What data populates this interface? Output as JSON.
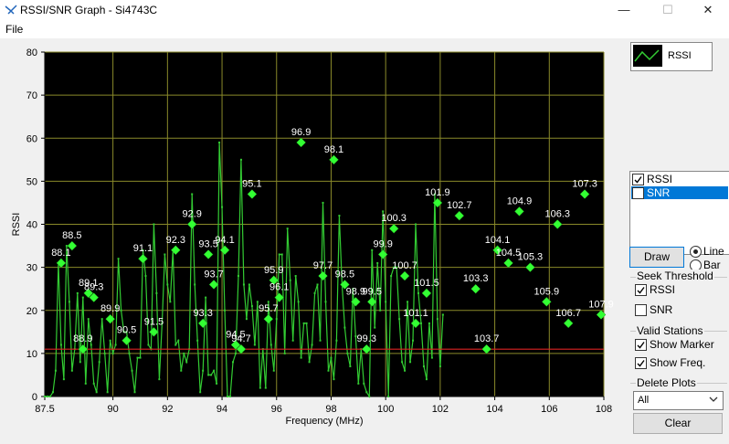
{
  "window": {
    "title": "RSSI/SNR Graph - Si4743C",
    "minimize": "—",
    "maximize": "☐",
    "close": "✕"
  },
  "menu": {
    "file": "File"
  },
  "legend": {
    "label": "RSSI",
    "color": "#22cc22"
  },
  "series_list": {
    "items": [
      {
        "label": "RSSI",
        "checked": true,
        "selected": false
      },
      {
        "label": "SNR",
        "checked": false,
        "selected": true
      }
    ]
  },
  "controls": {
    "draw": "Draw",
    "line": "Line",
    "bar": "Bar",
    "mode": "Line",
    "seek_threshold": {
      "title": "Seek Threshold",
      "rssi": {
        "label": "RSSI",
        "checked": true
      },
      "snr": {
        "label": "SNR",
        "checked": false
      }
    },
    "valid_stations": {
      "title": "Valid Stations",
      "show_marker": {
        "label": "Show Marker",
        "checked": true
      },
      "show_freq": {
        "label": "Show Freq.",
        "checked": true
      }
    },
    "delete_plots": {
      "title": "Delete Plots",
      "value": "All"
    },
    "clear": "Clear"
  },
  "chart_data": {
    "type": "line",
    "xlabel": "Frequency (MHz)",
    "ylabel": "RSSI",
    "xlim": [
      87.5,
      108
    ],
    "ylim": [
      0,
      80
    ],
    "yticks": [
      0,
      10,
      20,
      30,
      40,
      50,
      60,
      70,
      80
    ],
    "xticks": [
      "87.5",
      "90",
      "92",
      "94",
      "96",
      "98",
      "100",
      "102",
      "104",
      "106",
      "108"
    ],
    "xtick_values": [
      87.5,
      90,
      92,
      94,
      96,
      98,
      100,
      102,
      104,
      106,
      108
    ],
    "threshold": 11,
    "grid": true,
    "background": "#000000",
    "grid_color": "#8a8a2a",
    "line_color": "#33cc33",
    "marker_color": "#33ff33",
    "threshold_color": "#dd2222",
    "x": [
      87.5,
      87.6,
      87.7,
      87.8,
      87.9,
      88.0,
      88.1,
      88.2,
      88.3,
      88.4,
      88.5,
      88.6,
      88.7,
      88.8,
      88.9,
      89.0,
      89.1,
      89.2,
      89.3,
      89.4,
      89.5,
      89.6,
      89.7,
      89.8,
      89.9,
      90.0,
      90.1,
      90.2,
      90.3,
      90.4,
      90.5,
      90.6,
      90.7,
      90.8,
      90.9,
      91.0,
      91.1,
      91.2,
      91.3,
      91.4,
      91.5,
      91.6,
      91.7,
      91.8,
      91.9,
      92.0,
      92.1,
      92.2,
      92.3,
      92.4,
      92.5,
      92.6,
      92.7,
      92.8,
      92.9,
      93.0,
      93.1,
      93.2,
      93.3,
      93.4,
      93.5,
      93.6,
      93.7,
      93.8,
      93.9,
      94.0,
      94.1,
      94.2,
      94.3,
      94.4,
      94.5,
      94.6,
      94.7,
      94.8,
      94.9,
      95.0,
      95.1,
      95.2,
      95.3,
      95.4,
      95.5,
      95.6,
      95.7,
      95.8,
      95.9,
      96.0,
      96.1,
      96.2,
      96.3,
      96.4,
      96.5,
      96.6,
      96.7,
      96.8,
      96.9,
      97.0,
      97.1,
      97.2,
      97.3,
      97.4,
      97.5,
      97.6,
      97.7,
      97.8,
      97.9,
      98.0,
      98.1,
      98.2,
      98.3,
      98.4,
      98.5,
      98.6,
      98.7,
      98.8,
      98.9,
      99.0,
      99.1,
      99.2,
      99.3,
      99.4,
      99.5,
      99.6,
      99.7,
      99.8,
      99.9,
      100.0,
      100.1,
      100.2,
      100.3,
      100.4,
      100.5,
      100.6,
      100.7,
      100.8,
      100.9,
      101.0,
      101.1,
      101.2,
      101.3,
      101.4,
      101.5,
      101.6,
      101.7,
      101.8,
      101.9,
      102.0,
      102.1,
      102.2,
      102.3,
      102.4,
      102.5,
      102.6,
      102.7,
      102.8,
      102.9,
      103.0,
      103.1,
      103.2,
      103.3,
      103.4,
      103.5,
      103.6,
      103.7,
      103.8,
      103.9,
      104.0,
      104.1,
      104.2,
      104.3,
      104.4,
      104.5,
      104.6,
      104.7,
      104.8,
      104.9,
      105.0,
      105.1,
      105.2,
      105.3,
      105.4,
      105.5,
      105.6,
      105.7,
      105.8,
      105.9,
      106.0,
      106.1,
      106.2,
      106.3,
      106.4,
      106.5,
      106.6,
      106.7,
      106.8,
      106.9,
      107.0,
      107.1,
      107.2,
      107.3,
      107.4,
      107.5,
      107.6,
      107.7,
      107.8,
      107.9,
      108.0
    ],
    "y": [
      0,
      0,
      0,
      1,
      6,
      31,
      12,
      4,
      35,
      22,
      6,
      11,
      24,
      8,
      23,
      3,
      18,
      12,
      3,
      1,
      8,
      18,
      10,
      1,
      13,
      10,
      12,
      32,
      20,
      15,
      15,
      10,
      6,
      1,
      9,
      9,
      34,
      28,
      12,
      11,
      40,
      24,
      4,
      17,
      33,
      26,
      22,
      34,
      12,
      13,
      6,
      10,
      8,
      11,
      47,
      26,
      13,
      1,
      6,
      23,
      5,
      5,
      6,
      3,
      59,
      44,
      20,
      0,
      0,
      8,
      10,
      28,
      55,
      26,
      18,
      26,
      21,
      12,
      22,
      2,
      11,
      2,
      22,
      12,
      6,
      18,
      33,
      33,
      10,
      39,
      27,
      13,
      28,
      22,
      9,
      17,
      17,
      8,
      12,
      24,
      26,
      13,
      45,
      22,
      6,
      9,
      4,
      13,
      42,
      26,
      16,
      10,
      7,
      25,
      14,
      3,
      11,
      3,
      1,
      0,
      34,
      16,
      31,
      20,
      43,
      22,
      0,
      28,
      30,
      30,
      18,
      8,
      6,
      22,
      8,
      13,
      40,
      24,
      17,
      7,
      4,
      17,
      9,
      47,
      18,
      7,
      19
    ],
    "markers": [
      {
        "x": 88.1,
        "y": 31,
        "label": "88.1"
      },
      {
        "x": 88.5,
        "y": 35,
        "label": "88.5"
      },
      {
        "x": 88.9,
        "y": 11,
        "label": "88.9"
      },
      {
        "x": 89.1,
        "y": 24,
        "label": "89.1"
      },
      {
        "x": 89.3,
        "y": 23,
        "label": "89.3"
      },
      {
        "x": 89.9,
        "y": 18,
        "label": "89.9"
      },
      {
        "x": 90.5,
        "y": 13,
        "label": "90.5"
      },
      {
        "x": 91.1,
        "y": 32,
        "label": "91.1"
      },
      {
        "x": 91.5,
        "y": 15,
        "label": "91.5"
      },
      {
        "x": 92.3,
        "y": 34,
        "label": "92.3"
      },
      {
        "x": 92.9,
        "y": 40,
        "label": "92.9"
      },
      {
        "x": 93.3,
        "y": 17,
        "label": "93.3"
      },
      {
        "x": 93.5,
        "y": 33,
        "label": "93.5"
      },
      {
        "x": 93.7,
        "y": 26,
        "label": "93.7"
      },
      {
        "x": 94.1,
        "y": 34,
        "label": "94.1"
      },
      {
        "x": 94.5,
        "y": 12,
        "label": "94.5"
      },
      {
        "x": 94.7,
        "y": 11,
        "label": "94.7"
      },
      {
        "x": 95.1,
        "y": 47,
        "label": "95.1"
      },
      {
        "x": 95.7,
        "y": 18,
        "label": "95.7"
      },
      {
        "x": 95.9,
        "y": 27,
        "label": "95.9"
      },
      {
        "x": 96.1,
        "y": 23,
        "label": "96.1"
      },
      {
        "x": 96.9,
        "y": 59,
        "label": "96.9"
      },
      {
        "x": 97.7,
        "y": 28,
        "label": "97.7"
      },
      {
        "x": 98.1,
        "y": 55,
        "label": "98.1"
      },
      {
        "x": 98.5,
        "y": 26,
        "label": "98.5"
      },
      {
        "x": 98.9,
        "y": 22,
        "label": "98.9"
      },
      {
        "x": 99.3,
        "y": 11,
        "label": "99.3"
      },
      {
        "x": 99.5,
        "y": 22,
        "label": "99.5"
      },
      {
        "x": 99.9,
        "y": 33,
        "label": "99.9"
      },
      {
        "x": 100.3,
        "y": 39,
        "label": "100.3"
      },
      {
        "x": 100.7,
        "y": 28,
        "label": "100.7"
      },
      {
        "x": 101.1,
        "y": 17,
        "label": "101.1"
      },
      {
        "x": 101.5,
        "y": 24,
        "label": "101.5"
      },
      {
        "x": 101.9,
        "y": 45,
        "label": "101.9"
      },
      {
        "x": 102.7,
        "y": 42,
        "label": "102.7"
      },
      {
        "x": 103.3,
        "y": 25,
        "label": "103.3"
      },
      {
        "x": 103.7,
        "y": 11,
        "label": "103.7"
      },
      {
        "x": 104.1,
        "y": 34,
        "label": "104.1"
      },
      {
        "x": 104.5,
        "y": 31,
        "label": "104.5"
      },
      {
        "x": 104.9,
        "y": 43,
        "label": "104.9"
      },
      {
        "x": 105.3,
        "y": 30,
        "label": "105.3"
      },
      {
        "x": 105.9,
        "y": 22,
        "label": "105.9"
      },
      {
        "x": 106.3,
        "y": 40,
        "label": "106.3"
      },
      {
        "x": 106.7,
        "y": 17,
        "label": "106.7"
      },
      {
        "x": 107.3,
        "y": 47,
        "label": "107.3"
      },
      {
        "x": 107.9,
        "y": 19,
        "label": "107.9"
      }
    ]
  }
}
